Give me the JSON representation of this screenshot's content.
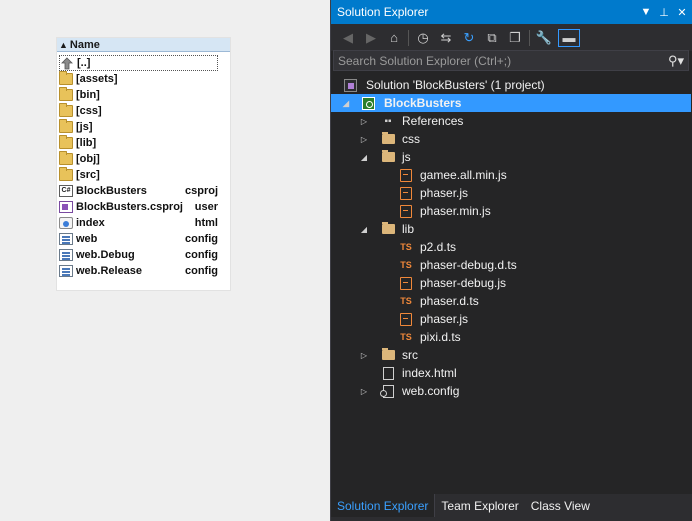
{
  "file_panel": {
    "header": "Name",
    "rows": [
      {
        "name": "[..]",
        "ext": "",
        "icon": "up-dir-icon",
        "selected": true
      },
      {
        "name": "[assets]",
        "ext": "",
        "icon": "folder-icon"
      },
      {
        "name": "[bin]",
        "ext": "",
        "icon": "folder-icon"
      },
      {
        "name": "[css]",
        "ext": "",
        "icon": "folder-icon"
      },
      {
        "name": "[js]",
        "ext": "",
        "icon": "folder-icon"
      },
      {
        "name": "[lib]",
        "ext": "",
        "icon": "folder-icon"
      },
      {
        "name": "[obj]",
        "ext": "",
        "icon": "folder-icon"
      },
      {
        "name": "[src]",
        "ext": "",
        "icon": "folder-icon"
      },
      {
        "name": "BlockBusters",
        "ext": "csproj",
        "icon": "csproj-icon"
      },
      {
        "name": "BlockBusters.csproj",
        "ext": "user",
        "icon": "vs-user-icon"
      },
      {
        "name": "index",
        "ext": "html",
        "icon": "html-icon"
      },
      {
        "name": "web",
        "ext": "config",
        "icon": "config-icon"
      },
      {
        "name": "web.Debug",
        "ext": "config",
        "icon": "config-icon"
      },
      {
        "name": "web.Release",
        "ext": "config",
        "icon": "config-icon"
      }
    ]
  },
  "solution_explorer": {
    "title": "Solution Explorer",
    "search_placeholder": "Search Solution Explorer (Ctrl+;)",
    "tree": [
      {
        "label": "Solution 'BlockBusters' (1 project)",
        "level": 0,
        "expander": "",
        "icon": "solution-icon"
      },
      {
        "label": "BlockBusters",
        "level": 0,
        "expander": "open",
        "icon": "project-icon",
        "selected": true
      },
      {
        "label": "References",
        "level": 1,
        "expander": "closed",
        "icon": "references-icon"
      },
      {
        "label": "css",
        "level": 1,
        "expander": "closed",
        "icon": "folder-icon"
      },
      {
        "label": "js",
        "level": 1,
        "expander": "open",
        "icon": "folder-icon"
      },
      {
        "label": "gamee.all.min.js",
        "level": 2,
        "expander": "",
        "icon": "js-file-icon"
      },
      {
        "label": "phaser.js",
        "level": 2,
        "expander": "",
        "icon": "js-file-icon"
      },
      {
        "label": "phaser.min.js",
        "level": 2,
        "expander": "",
        "icon": "js-file-icon"
      },
      {
        "label": "lib",
        "level": 1,
        "expander": "open",
        "icon": "folder-icon"
      },
      {
        "label": "p2.d.ts",
        "level": 2,
        "expander": "",
        "icon": "ts-file-icon"
      },
      {
        "label": "phaser-debug.d.ts",
        "level": 2,
        "expander": "",
        "icon": "ts-file-icon"
      },
      {
        "label": "phaser-debug.js",
        "level": 2,
        "expander": "",
        "icon": "js-file-icon"
      },
      {
        "label": "phaser.d.ts",
        "level": 2,
        "expander": "",
        "icon": "ts-file-icon"
      },
      {
        "label": "phaser.js",
        "level": 2,
        "expander": "",
        "icon": "js-file-icon"
      },
      {
        "label": "pixi.d.ts",
        "level": 2,
        "expander": "",
        "icon": "ts-file-icon"
      },
      {
        "label": "src",
        "level": 1,
        "expander": "closed",
        "icon": "folder-icon"
      },
      {
        "label": "index.html",
        "level": 1,
        "expander": "",
        "icon": "html-file-icon"
      },
      {
        "label": "web.config",
        "level": 1,
        "expander": "closed",
        "icon": "config-file-icon"
      }
    ],
    "tabs": [
      {
        "label": "Solution Explorer",
        "active": true
      },
      {
        "label": "Team Explorer",
        "active": false
      },
      {
        "label": "Class View",
        "active": false
      }
    ],
    "ts_badge": "TS",
    "cs_badge": "C#"
  },
  "colors": {
    "accent": "#007acc",
    "selection": "#3399ff",
    "background": "#252526"
  }
}
